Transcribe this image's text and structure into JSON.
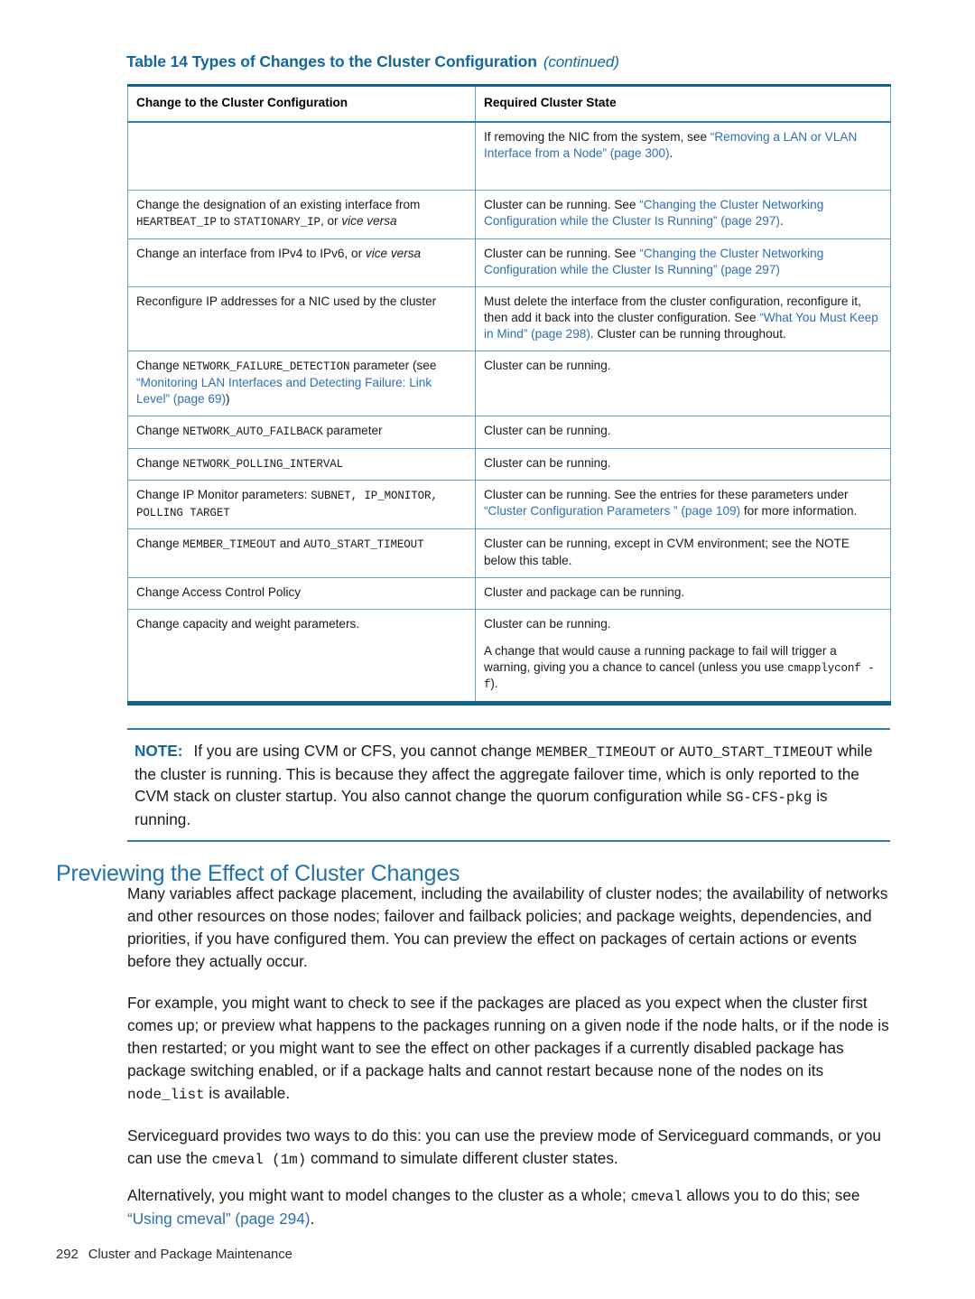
{
  "table": {
    "caption_main": "Table 14 Types of Changes to the Cluster Configuration",
    "caption_continued": "(continued)",
    "headers": [
      "Change to the Cluster Configuration",
      "Required Cluster State"
    ],
    "rows": [
      {
        "change_plain": "",
        "state_lead": "If removing the NIC from the system, see ",
        "state_link": "“Removing a LAN or VLAN Interface from a Node” (page 300)",
        "state_tail": "."
      },
      {
        "change_lead": "Change the designation of an existing interface from ",
        "change_mono1": "HEARTBEAT_IP",
        "change_mid": " to ",
        "change_mono2": "STATIONARY_IP",
        "change_tail": ", or ",
        "change_italic": "vice versa",
        "state_lead": "Cluster can be running. See ",
        "state_link": "“Changing the Cluster Networking Configuration while the Cluster Is Running” (page 297)",
        "state_tail": "."
      },
      {
        "change_lead": "Change an interface from IPv4 to IPv6, or ",
        "change_italic": "vice versa",
        "state_lead": "Cluster can be running. See ",
        "state_link": "“Changing the Cluster Networking Configuration while the Cluster Is Running” (page 297)",
        "state_tail": ""
      },
      {
        "change_plain": "Reconfigure IP addresses for a NIC used by the cluster",
        "state_lead": "Must delete the interface from the cluster configuration, reconfigure it, then add it back into the cluster configuration. See ",
        "state_link": "“What You Must Keep in Mind” (page 298)",
        "state_tail": ". Cluster can be running throughout."
      },
      {
        "change_lead": "Change ",
        "change_mono1": "NETWORK_FAILURE_DETECTION",
        "change_mid": " parameter (see ",
        "change_link": "“Monitoring LAN Interfaces and Detecting Failure: Link Level” (page 69)",
        "change_tail": ")",
        "state_plain": "Cluster can be running."
      },
      {
        "change_lead": "Change ",
        "change_mono1": "NETWORK_AUTO_FAILBACK",
        "change_mid": " parameter",
        "state_plain": "Cluster can be running."
      },
      {
        "change_lead": "Change ",
        "change_mono1": "NETWORK_POLLING_INTERVAL",
        "state_plain": "Cluster can be running."
      },
      {
        "change_lead": "Change IP Monitor parameters: ",
        "change_mono1": "SUBNET, IP_MONITOR, POLLING TARGET",
        "state_lead": "Cluster can be running. See the entries for these parameters under ",
        "state_link": "“Cluster Configuration Parameters ” (page 109)",
        "state_tail": " for more information."
      },
      {
        "change_lead": "Change ",
        "change_mono1": "MEMBER_TIMEOUT",
        "change_mid": " and ",
        "change_mono2": "AUTO_START_TIMEOUT",
        "state_plain": "Cluster can be running, except in CVM environment; see the NOTE below this table."
      },
      {
        "change_plain": "Change Access Control Policy",
        "state_plain": "Cluster and package can be running."
      },
      {
        "change_plain": "Change capacity and weight parameters.",
        "state_para1": "Cluster can be running.",
        "state_para2_lead": "A change that would cause a running package to fail will trigger a warning, giving you a chance to cancel (unless you use ",
        "state_para2_mono": "cmapplyconf -f",
        "state_para2_tail": ")."
      }
    ]
  },
  "note": {
    "label": "NOTE:",
    "text_lead": "If you are using CVM or CFS, you cannot change ",
    "mono1": "MEMBER_TIMEOUT",
    "mid1": " or ",
    "mono2": "AUTO_START_TIMEOUT",
    "mid2": " while the cluster is running. This is because they affect the aggregate failover time, which is only reported to the CVM stack on cluster startup. You also cannot change the quorum configuration while ",
    "mono3": "SG-CFS-pkg",
    "tail": " is running."
  },
  "section": {
    "heading": "Previewing the Effect of Cluster Changes",
    "paragraph1": "Many variables affect package placement, including the availability of cluster nodes; the availability of networks and other resources on those nodes; failover and failback policies; and package weights, dependencies, and priorities, if you have configured them. You can preview the effect on packages of certain actions or events before they actually occur.",
    "paragraph2_lead": "For example, you might want to check to see if the packages are placed as you expect when the cluster first comes up; or preview what happens to the packages running on a given node if the node halts, or if the node is then restarted; or you might want to see the effect on other packages if a currently disabled package has package switching enabled, or if a package halts and cannot restart because none of the nodes on its ",
    "paragraph2_mono": "node_list",
    "paragraph2_tail": " is available.",
    "paragraph3_lead": "Serviceguard provides two ways to do this: you can use the preview mode of Serviceguard commands, or you can use the ",
    "paragraph3_mono": "cmeval (1m)",
    "paragraph3_tail": " command to simulate different cluster states.",
    "paragraph4_lead": "Alternatively, you might want to model changes to the cluster as a whole; ",
    "paragraph4_mono": "cmeval",
    "paragraph4_mid": " allows you to do this; see ",
    "paragraph4_link": "“Using cmeval” (page 294)",
    "paragraph4_tail": "."
  },
  "footer": {
    "page_number": "292",
    "chapter_title": "Cluster and Package Maintenance"
  },
  "colors": {
    "heading_blue": "#2272ab",
    "caption_blue": "#13679b",
    "link_blue": "#2d6fb3",
    "table_border_dark": "#11628f",
    "table_border_light": "#6aa3cd"
  }
}
